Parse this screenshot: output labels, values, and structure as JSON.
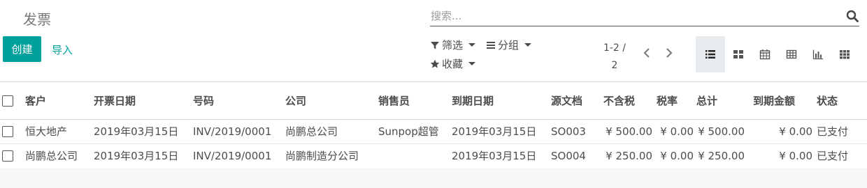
{
  "header": {
    "title": "发票",
    "create_label": "创建",
    "import_label": "导入"
  },
  "search": {
    "placeholder": "搜索..."
  },
  "filters": {
    "filter_label": "筛选",
    "group_label": "分组",
    "favorites_label": "收藏"
  },
  "pager": {
    "value": "1-2 / 2"
  },
  "views": [
    "list-icon",
    "kanban-icon",
    "calendar-icon",
    "pivot-icon",
    "graph-icon",
    "grid-icon"
  ],
  "table": {
    "headers": {
      "customer": "客户",
      "invoice_date": "开票日期",
      "number": "号码",
      "company": "公司",
      "salesperson": "销售员",
      "due_date": "到期日期",
      "source": "源文档",
      "untaxed": "不含税",
      "tax": "税率",
      "total": "总计",
      "amount_due": "到期金额",
      "status": "状态"
    },
    "rows": [
      {
        "customer": "恒大地产",
        "invoice_date": "2019年03月15日",
        "number": "INV/2019/0001",
        "company": "尚鹏总公司",
        "salesperson": "Sunpop超管",
        "due_date": "2019年03月15日",
        "source": "SO003",
        "untaxed": "¥ 500.00",
        "tax": "¥ 0.00",
        "total": "¥ 500.00",
        "amount_due": "¥ 0.00",
        "status": "已支付"
      },
      {
        "customer": "尚鹏总公司",
        "invoice_date": "2019年03月15日",
        "number": "INV/2019/0001",
        "company": "尚鹏制造分公司",
        "salesperson": "",
        "due_date": "2019年03月15日",
        "source": "SO004",
        "untaxed": "¥ 250.00",
        "tax": "¥ 0.00",
        "total": "¥ 250.00",
        "amount_due": "¥ 0.00",
        "status": "已支付"
      }
    ]
  },
  "colors": {
    "primary": "#00a09d",
    "text": "#4c4c4c",
    "active_view_bg": "#e9ecef"
  }
}
